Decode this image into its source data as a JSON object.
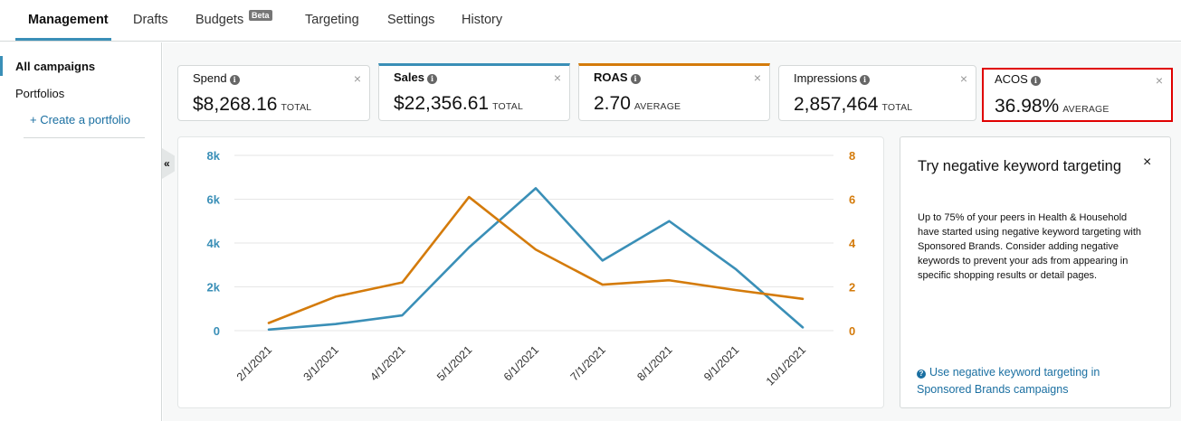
{
  "tabs": [
    {
      "label": "Management",
      "active": true
    },
    {
      "label": "Drafts"
    },
    {
      "label": "Budgets",
      "badge": "Beta"
    },
    {
      "label": "Targeting"
    },
    {
      "label": "Settings"
    },
    {
      "label": "History"
    }
  ],
  "sidebar": {
    "all_campaigns": "All campaigns",
    "portfolios": "Portfolios",
    "create_portfolio": "+ Create a portfolio",
    "collapse_glyph": "«"
  },
  "metrics": [
    {
      "name": "Spend",
      "value": "$8,268.16",
      "unit": "TOTAL"
    },
    {
      "name": "Sales",
      "value": "$22,356.61",
      "unit": "TOTAL"
    },
    {
      "name": "ROAS",
      "value": "2.70",
      "unit": "AVERAGE"
    },
    {
      "name": "Impressions",
      "value": "2,857,464",
      "unit": "TOTAL"
    },
    {
      "name": "ACOS",
      "value": "36.98%",
      "unit": "AVERAGE"
    }
  ],
  "close_glyph": "×",
  "info_glyph": "i",
  "colors": {
    "sales": "#3a8fb7",
    "roas": "#d47b0b",
    "highlight": "#e00000",
    "link": "#1a6fa1"
  },
  "chart_data": {
    "type": "line",
    "categories": [
      "2/1/2021",
      "3/1/2021",
      "4/1/2021",
      "5/1/2021",
      "6/1/2021",
      "7/1/2021",
      "8/1/2021",
      "9/1/2021",
      "10/1/2021"
    ],
    "series": [
      {
        "values": [
          50,
          300,
          700,
          3800,
          6500,
          3200,
          5000,
          2800,
          150
        ],
        "axis": "left",
        "color": "#3a8fb7"
      },
      {
        "values": [
          0.35,
          1.55,
          2.2,
          6.1,
          3.7,
          2.1,
          2.3,
          1.85,
          1.45
        ],
        "axis": "right",
        "color": "#d47b0b"
      }
    ],
    "y_left": {
      "ticks": [
        0,
        2000,
        4000,
        6000,
        8000
      ],
      "tick_labels": [
        "0",
        "2k",
        "4k",
        "6k",
        "8k"
      ],
      "lim": [
        0,
        8000
      ]
    },
    "y_right": {
      "ticks": [
        0,
        2,
        4,
        6,
        8
      ],
      "tick_labels": [
        "0",
        "2",
        "4",
        "6",
        "8"
      ],
      "lim": [
        0,
        8
      ]
    },
    "grid": true,
    "legend": "none"
  },
  "promo": {
    "title": "Try negative keyword targeting",
    "body": "Up to 75% of your peers in Health & Household have started using negative keyword targeting with Sponsored Brands. Consider adding negative keywords to prevent your ads from appearing in specific shopping results or detail pages.",
    "link": "Use negative keyword targeting in Sponsored Brands campaigns",
    "link_icon": "?"
  }
}
